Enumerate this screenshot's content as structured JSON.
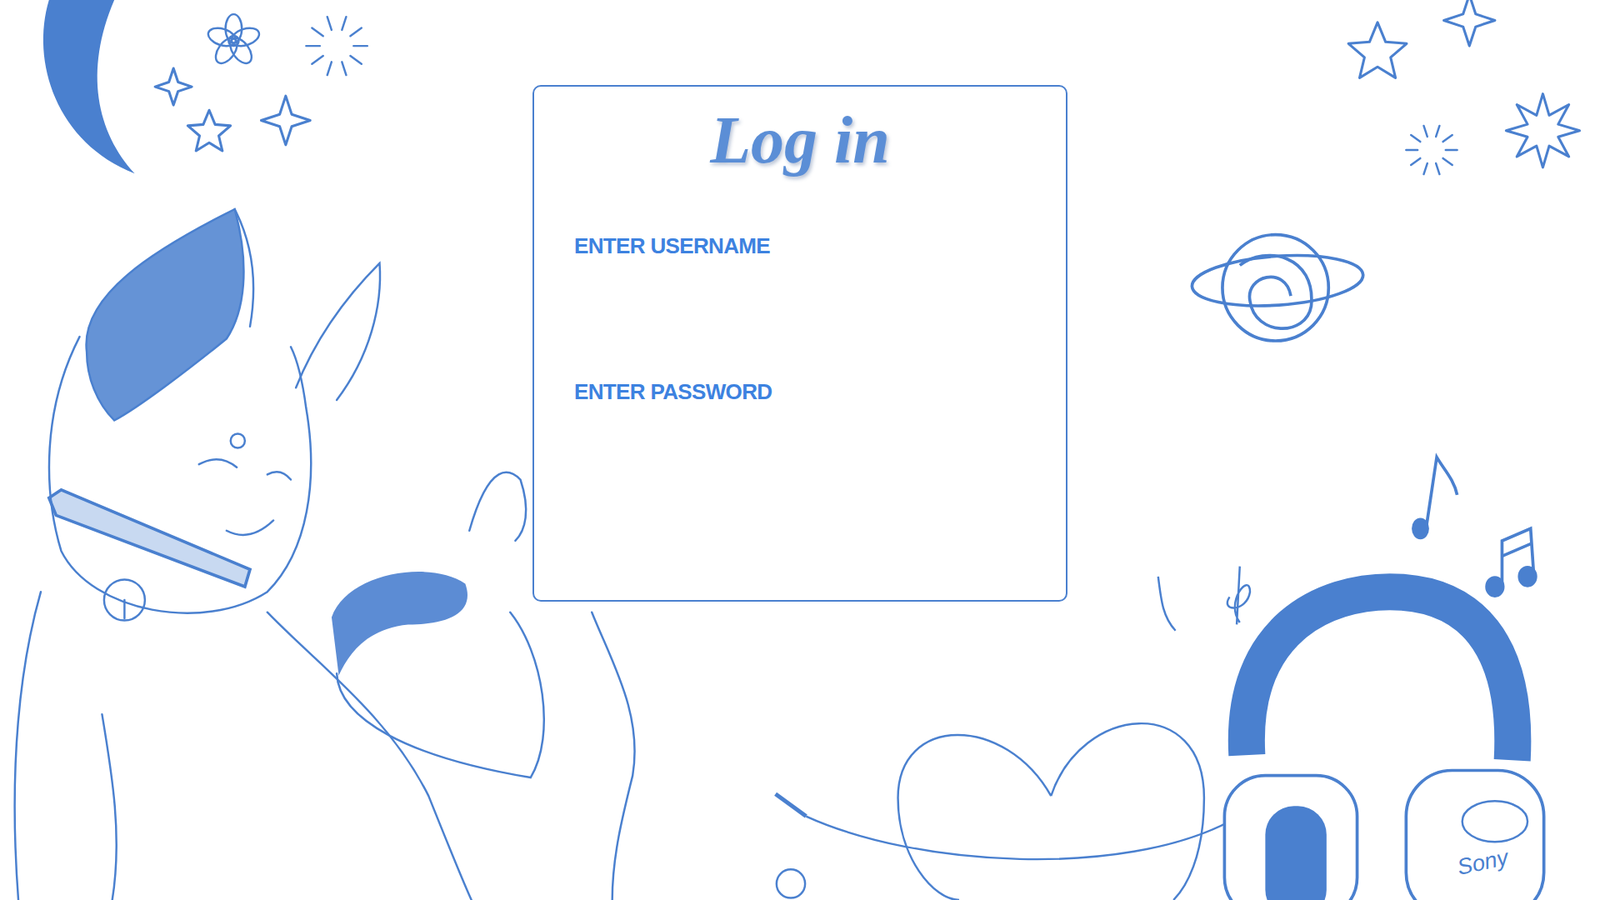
{
  "title": "Log in",
  "fields": [
    {
      "label": "ENTER USERNAME"
    },
    {
      "label": "ENTER PASSWORD"
    }
  ],
  "illustration": {
    "headphones_brand": "Sony"
  }
}
